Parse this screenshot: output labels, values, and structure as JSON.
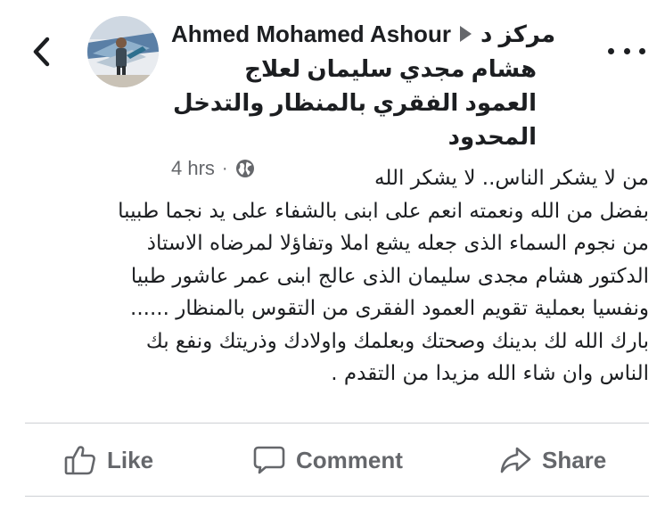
{
  "header": {
    "author": "Ahmed Mohamed Ashour",
    "center_prefix": "مركز د",
    "page_name": "هشام مجدي سليمان لعلاج العمود الفقري بالمنظار والتدخل المحدود",
    "time": "4 hrs",
    "separator": "·"
  },
  "post": {
    "lines": [
      "من لا يشكر الناس.. لا يشكر الله",
      "بفضل من الله ونعمته انعم على ابنى بالشفاء على يد نجما  طبيبا",
      "من نجوم السماء الذى جعله يشع املا وتفاؤلا لمرضاه الاستاذ",
      "الدكتور هشام مجدى سليمان الذى عالج ابنى عمر عاشور طبيا",
      "ونفسيا بعملية تقويم العمود الفقرى من التقوس بالمنظار ......",
      "بارك الله لك بدينك وصحتك وبعلمك واولادك وذريتك ونفع بك",
      "الناس وان شاء الله مزيدا من التقدم ."
    ]
  },
  "actions": {
    "like": "Like",
    "comment": "Comment",
    "share": "Share"
  },
  "icons": {
    "back": "chevron-left-icon",
    "more": "more-horizontal-icon",
    "audience": "globe-icon",
    "like": "thumbs-up-icon",
    "comment": "comment-bubble-icon",
    "share": "share-arrow-icon",
    "breadcrumb": "triangle-right-icon"
  },
  "colors": {
    "text": "#1c1e21",
    "secondary": "#65676b",
    "divider": "#ced0d4",
    "background": "#ffffff"
  }
}
